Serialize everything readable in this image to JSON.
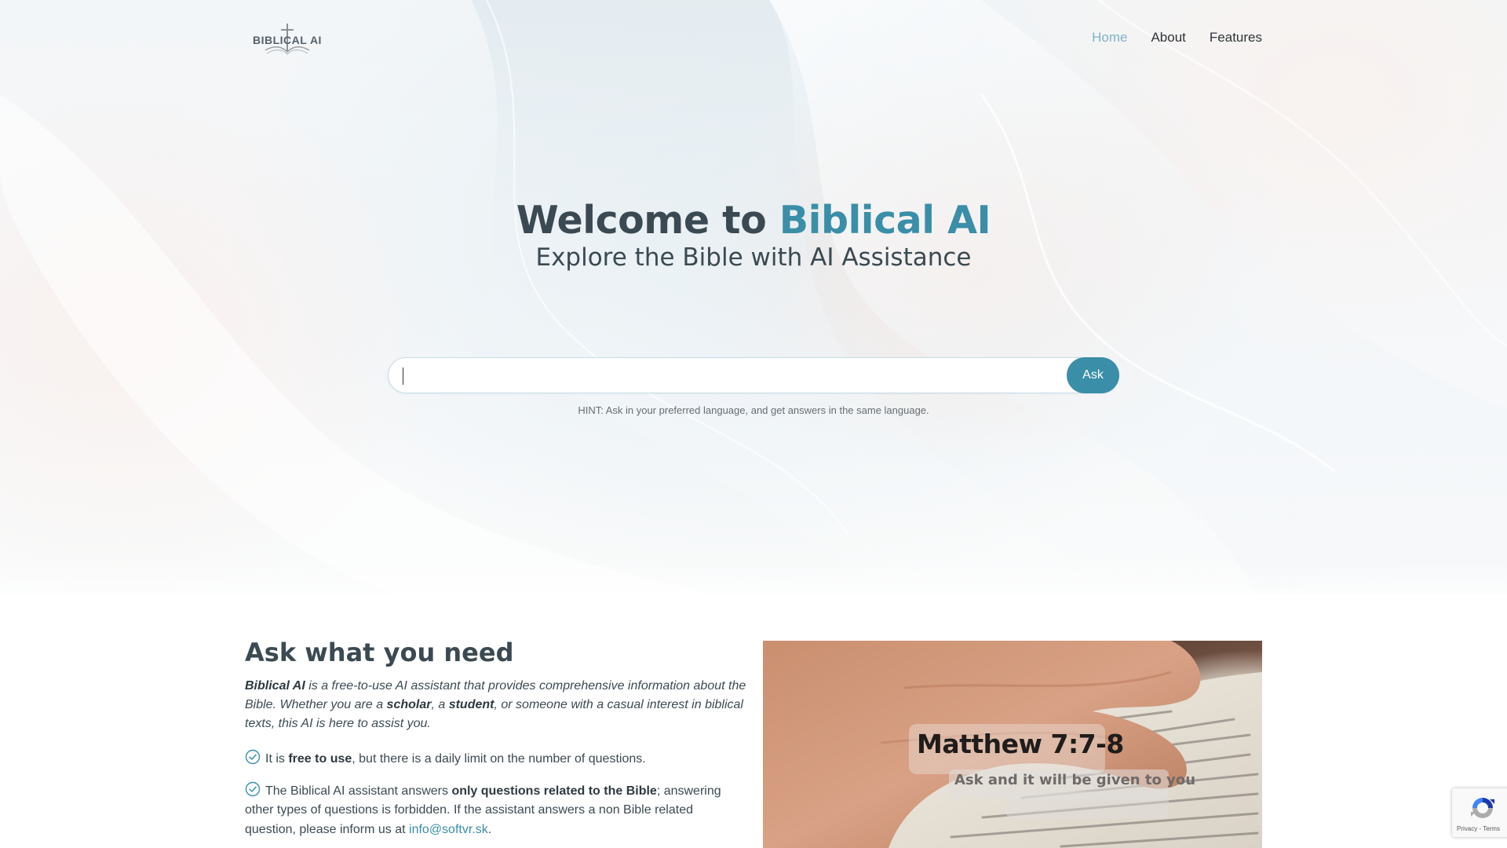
{
  "brand": {
    "logo_text": "BIBLICAL AI",
    "accent_color": "#3a8ea8",
    "text_color": "#3b4a52",
    "nav_active_color": "#7fb3c6"
  },
  "nav": {
    "items": [
      {
        "label": "Home",
        "active": true
      },
      {
        "label": "About",
        "active": false
      },
      {
        "label": "Features",
        "active": false
      }
    ]
  },
  "hero": {
    "title_prefix": "Welcome to ",
    "title_accent": "Biblical AI",
    "subtitle": "Explore the Bible with AI Assistance",
    "search": {
      "value": "",
      "placeholder": "",
      "button_label": "Ask"
    },
    "hint": "HINT: Ask in your preferred language, and get answers in the same language."
  },
  "about": {
    "title": "Ask what you need",
    "intro": {
      "brand": "Biblical AI",
      "part1": " is a free-to-use AI assistant that provides comprehensive information about the Bible. Whether you are a ",
      "scholar": "scholar",
      "part2": ", a ",
      "student": "student",
      "part3": ", or someone with a casual interest in biblical texts, this AI is here to assist you."
    },
    "features": [
      {
        "icon": "check-circle-icon",
        "pre": "It is ",
        "bold": "free to use",
        "post": ", but there is a daily limit on the number of questions."
      },
      {
        "icon": "check-circle-icon",
        "pre": "The Biblical AI assistant answers ",
        "bold": "only questions related to the Bible",
        "post": "; answering other types of questions is forbidden. If the assistant answers a non Bible related question, please inform us at ",
        "email": "info@softvr.sk",
        "end": "."
      }
    ]
  },
  "media": {
    "verse_title": "Matthew 7:7-8",
    "verse_text": "Ask and it will be given to you"
  },
  "recaptcha": {
    "links": "Privacy - Terms"
  }
}
